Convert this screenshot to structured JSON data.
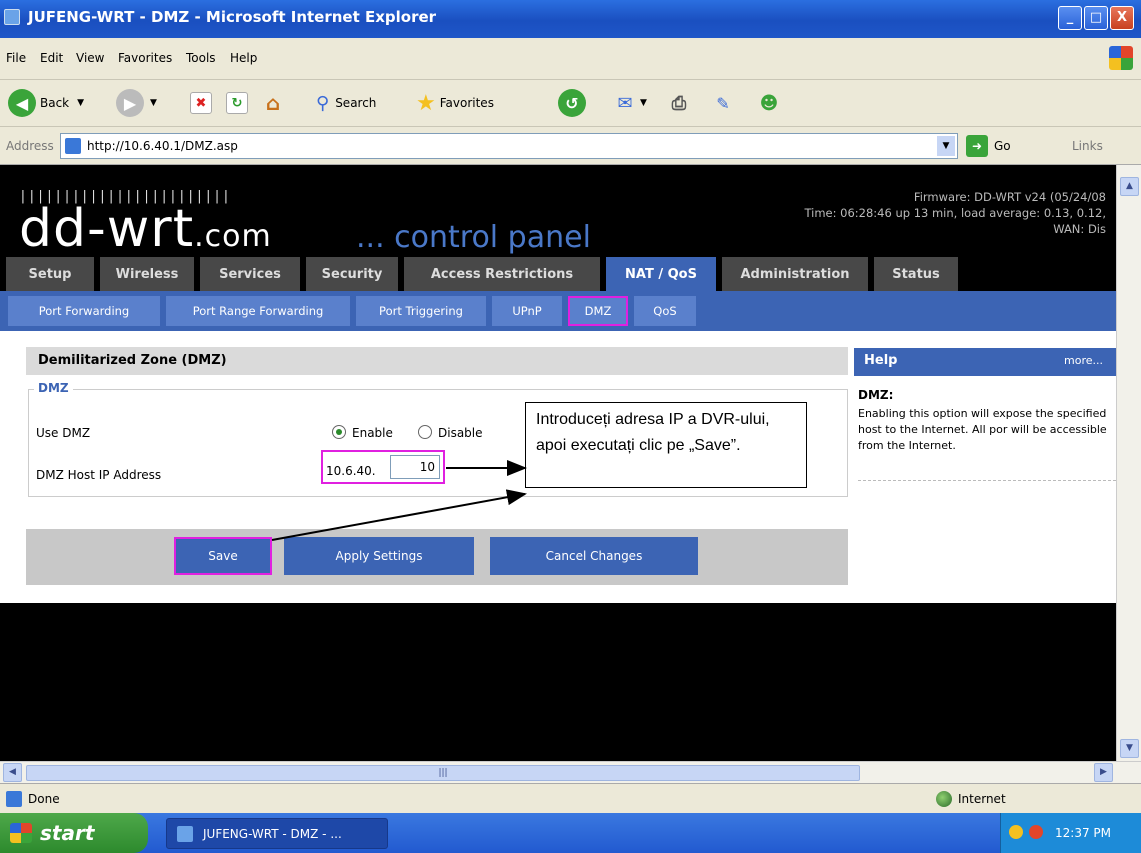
{
  "window": {
    "title": "JUFENG-WRT - DMZ - Microsoft Internet Explorer",
    "min": "_",
    "max": "□",
    "close": "X"
  },
  "menu": [
    "File",
    "Edit",
    "View",
    "Favorites",
    "Tools",
    "Help"
  ],
  "toolbar": {
    "back": "Back",
    "search": "Search",
    "favorites": "Favorites"
  },
  "address": {
    "label": "Address",
    "url": "http://10.6.40.1/DMZ.asp",
    "go": "Go",
    "links": "Links"
  },
  "header": {
    "bars": "||||||||||||||||||||||||",
    "logo_main": "dd-wrt",
    "logo_tld": ".com",
    "control_panel": "... control panel",
    "firmware": "Firmware: DD-WRT v24 (05/24/08",
    "time": "Time: 06:28:46 up 13 min, load average: 0.13, 0.12,",
    "wan": "WAN: Dis"
  },
  "tabs": [
    "Setup",
    "Wireless",
    "Services",
    "Security",
    "Access Restrictions",
    "NAT / QoS",
    "Administration",
    "Status"
  ],
  "active_tab": "NAT / QoS",
  "subtabs": [
    "Port Forwarding",
    "Port Range Forwarding",
    "Port Triggering",
    "UPnP",
    "DMZ",
    "QoS"
  ],
  "active_subtab": "DMZ",
  "main": {
    "title": "Demilitarized Zone (DMZ)",
    "legend": "DMZ",
    "use_dmz_label": "Use DMZ",
    "enable": "Enable",
    "disable": "Disable",
    "host_ip_label": "DMZ Host IP Address",
    "ip_prefix": "10.6.40.",
    "ip_last": "10"
  },
  "buttons": {
    "save": "Save",
    "apply": "Apply Settings",
    "cancel": "Cancel Changes"
  },
  "help": {
    "title": "Help",
    "more": "more...",
    "heading": "DMZ:",
    "text": "Enabling this option will expose the specified host to the Internet. All por will be accessible from the Internet."
  },
  "callout": "Introduceți adresa IP a DVR-ului, apoi executați clic pe „Save”.",
  "status": {
    "text": "Done",
    "zone": "Internet"
  },
  "taskbar": {
    "start": "start",
    "task": "JUFENG-WRT - DMZ - ...",
    "clock": "12:37 PM"
  },
  "colors": {
    "accent": "#3c64b4",
    "highlight": "#e020e0",
    "xp_blue": "#225ad0"
  }
}
